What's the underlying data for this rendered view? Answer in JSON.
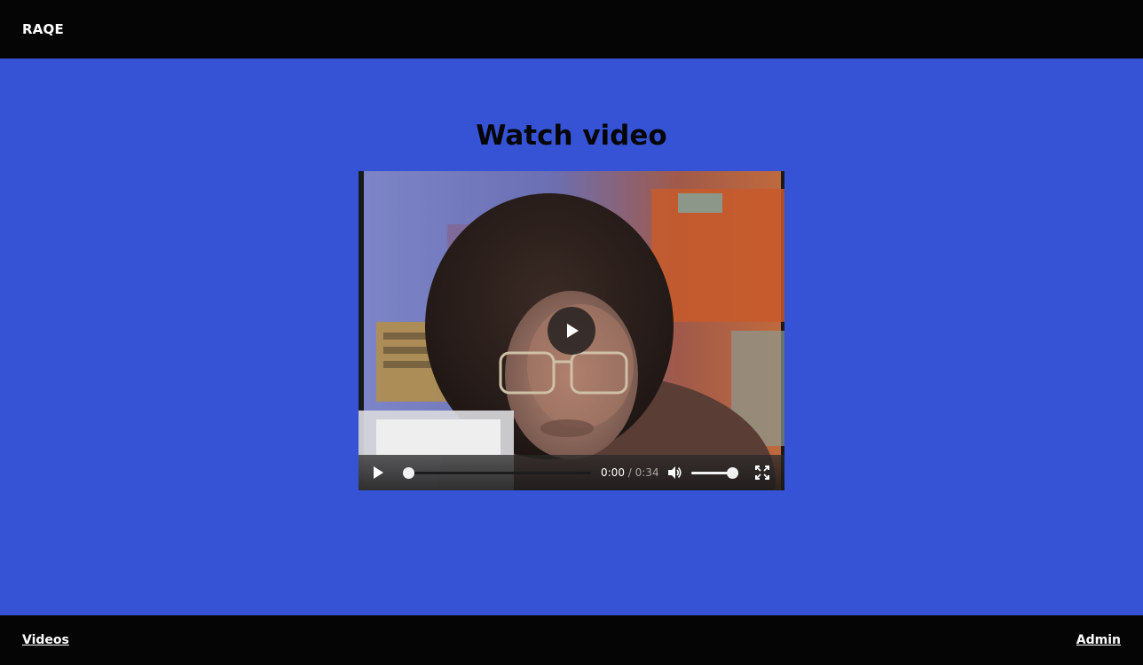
{
  "header": {
    "brand": "RAQE"
  },
  "main": {
    "title": "Watch video",
    "video": {
      "current_time": "0:00",
      "separator": " / ",
      "duration": "0:34",
      "progress_fraction": 0.0,
      "volume_fraction": 1.0
    }
  },
  "footer": {
    "videos_link": "Videos",
    "admin_link": "Admin"
  },
  "colors": {
    "page_background": "#3553d4",
    "bar_background": "#050505",
    "text_light": "#ffffff",
    "title_text": "#050505"
  },
  "icons": {
    "big_play": "play-icon",
    "control_play": "play-icon",
    "mute": "volume-icon",
    "fullscreen": "fullscreen-icon"
  }
}
